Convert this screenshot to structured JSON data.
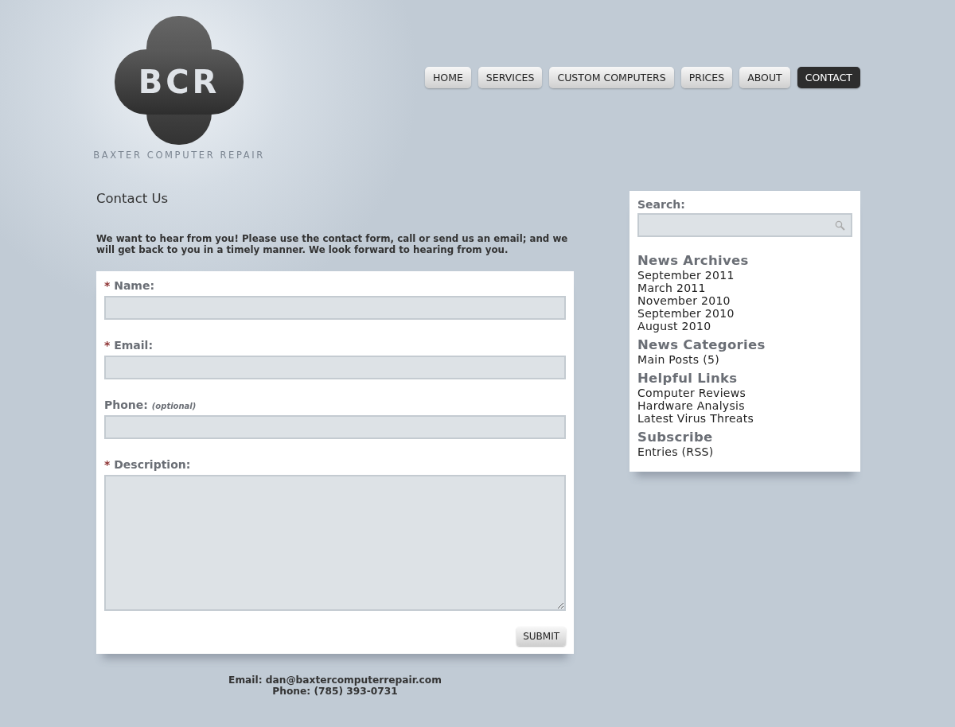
{
  "logo": {
    "letters": "BCR",
    "tagline": "BAXTER COMPUTER REPAIR"
  },
  "nav": [
    {
      "label": "HOME",
      "selected": false
    },
    {
      "label": "SERVICES",
      "selected": false
    },
    {
      "label": "CUSTOM COMPUTERS",
      "selected": false
    },
    {
      "label": "PRICES",
      "selected": false
    },
    {
      "label": "ABOUT",
      "selected": false
    },
    {
      "label": "CONTACT",
      "selected": true
    }
  ],
  "page_title": "Contact Us",
  "intro": "We want to hear from you! Please use the contact form, call or send us an email; and we will get back to you in a timely manner. We look forward to hearing from you.",
  "form": {
    "fields": [
      {
        "kind": "text",
        "mark": "*",
        "label": "Name:"
      },
      {
        "kind": "text",
        "mark": "*",
        "label": "Email:"
      },
      {
        "kind": "text",
        "label": "Phone:",
        "hint": "(optional)"
      },
      {
        "kind": "textarea",
        "mark": "*",
        "label": "Description:"
      }
    ],
    "submit": "SUBMIT"
  },
  "footer": {
    "email": "Email: dan@baxtercomputerrepair.com",
    "phone": "Phone: (785) 393-0731"
  },
  "sidebar": {
    "search_label": "Search:",
    "sections": [
      {
        "title": "News Archives",
        "links": [
          "September 2011",
          "March 2011",
          "November 2010",
          "September 2010",
          "August 2010"
        ]
      },
      {
        "title": "News Categories",
        "links": [
          "Main Posts (5)"
        ]
      },
      {
        "title": "Helpful Links",
        "links": [
          "Computer Reviews",
          "Hardware Analysis",
          "Latest Virus Threats"
        ]
      },
      {
        "title": "Subscribe",
        "links": [
          "Entries (RSS)"
        ]
      }
    ]
  }
}
